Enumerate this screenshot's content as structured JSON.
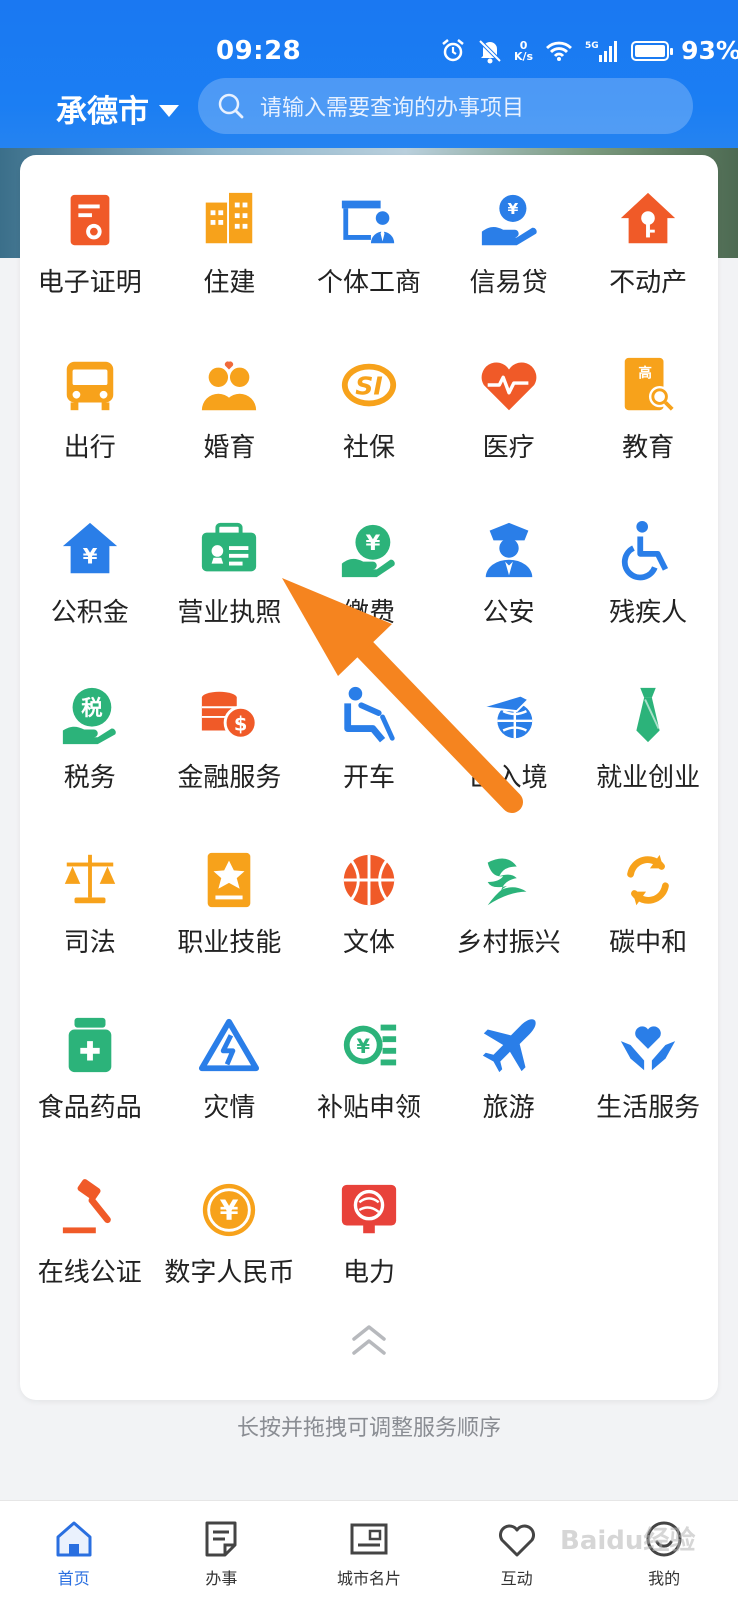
{
  "status_bar": {
    "time": "09:28",
    "net_speed_value": "0",
    "net_speed_unit": "K/s",
    "battery": "93%"
  },
  "header": {
    "city": "承德市",
    "search_placeholder": "请输入需要查询的办事项目"
  },
  "services": [
    {
      "label": "电子证明",
      "icon": "certificate-icon",
      "color": "#f05a28"
    },
    {
      "label": "住建",
      "icon": "buildings-icon",
      "color": "#f7a21b"
    },
    {
      "label": "个体工商",
      "icon": "shop-icon",
      "color": "#2a7ee8"
    },
    {
      "label": "信易贷",
      "icon": "loan-hand-icon",
      "color": "#2a7ee8"
    },
    {
      "label": "不动产",
      "icon": "house-key-icon",
      "color": "#f05a28"
    },
    {
      "label": "出行",
      "icon": "bus-icon",
      "color": "#f7a21b"
    },
    {
      "label": "婚育",
      "icon": "couple-icon",
      "color": "#f7a21b"
    },
    {
      "label": "社保",
      "icon": "social-security-icon",
      "color": "#f7a21b"
    },
    {
      "label": "医疗",
      "icon": "heart-pulse-icon",
      "color": "#f05a28"
    },
    {
      "label": "教育",
      "icon": "education-icon",
      "color": "#f7a21b"
    },
    {
      "label": "公积金",
      "icon": "housing-fund-icon",
      "color": "#2a7ee8"
    },
    {
      "label": "营业执照",
      "icon": "business-license-icon",
      "color": "#2cb37a"
    },
    {
      "label": "缴费",
      "icon": "payment-icon",
      "color": "#2cb37a"
    },
    {
      "label": "公安",
      "icon": "police-icon",
      "color": "#2a7ee8"
    },
    {
      "label": "残疾人",
      "icon": "wheelchair-icon",
      "color": "#2a7ee8"
    },
    {
      "label": "税务",
      "icon": "tax-icon",
      "color": "#2cb37a"
    },
    {
      "label": "金融服务",
      "icon": "finance-coins-icon",
      "color": "#f05a28"
    },
    {
      "label": "开车",
      "icon": "driver-seat-icon",
      "color": "#2a7ee8"
    },
    {
      "label": "出入境",
      "icon": "plane-globe-icon",
      "color": "#2a7ee8"
    },
    {
      "label": "就业创业",
      "icon": "tie-icon",
      "color": "#2cb37a"
    },
    {
      "label": "司法",
      "icon": "scales-icon",
      "color": "#f7a21b"
    },
    {
      "label": "职业技能",
      "icon": "skill-certificate-icon",
      "color": "#f7a21b"
    },
    {
      "label": "文体",
      "icon": "basketball-icon",
      "color": "#f05a28"
    },
    {
      "label": "乡村振兴",
      "icon": "rural-revitalization-icon",
      "color": "#2cb37a"
    },
    {
      "label": "碳中和",
      "icon": "carbon-cycle-icon",
      "color": "#f7a21b"
    },
    {
      "label": "食品药品",
      "icon": "medicine-bottle-icon",
      "color": "#2cb37a"
    },
    {
      "label": "灾情",
      "icon": "disaster-icon",
      "color": "#2a7ee8"
    },
    {
      "label": "补贴申领",
      "icon": "subsidy-coin-icon",
      "color": "#2cb37a"
    },
    {
      "label": "旅游",
      "icon": "airplane-icon",
      "color": "#2a7ee8"
    },
    {
      "label": "生活服务",
      "icon": "care-hands-icon",
      "color": "#2a7ee8"
    },
    {
      "label": "在线公证",
      "icon": "gavel-icon",
      "color": "#f05a28"
    },
    {
      "label": "数字人民币",
      "icon": "digital-rmb-icon",
      "color": "#f7a21b"
    },
    {
      "label": "电力",
      "icon": "power-icon",
      "color": "#e8423a"
    }
  ],
  "hint": "长按并拖拽可调整服务顺序",
  "nav": [
    {
      "label": "首页",
      "icon": "home-icon",
      "active": true
    },
    {
      "label": "办事",
      "icon": "document-icon",
      "active": false
    },
    {
      "label": "城市名片",
      "icon": "city-card-icon",
      "active": false
    },
    {
      "label": "互动",
      "icon": "heart-icon",
      "active": false
    },
    {
      "label": "我的",
      "icon": "profile-icon",
      "active": false
    }
  ],
  "watermark": "Baidu经验",
  "colors": {
    "header_blue": "#1a78f2",
    "annotation_arrow": "#f5841f",
    "nav_active": "#2a6fe0"
  }
}
